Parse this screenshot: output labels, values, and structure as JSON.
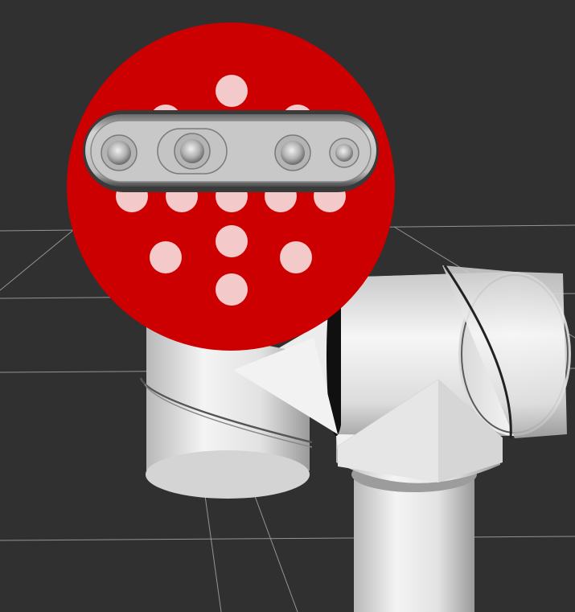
{
  "scene": {
    "background_color": "#303030",
    "grid_color": "#a0a0a0",
    "robot_body_color": "#e6e6e6",
    "marker_color": "#cc0000",
    "marker_dot_color": "#f2c8c8",
    "camera_color": "#c8c8c8",
    "objects": {
      "grid": "ground-grid",
      "arm": "robot-arm-links",
      "marker": "red-circular-calibration-target",
      "camera": "depth-camera-model"
    }
  }
}
